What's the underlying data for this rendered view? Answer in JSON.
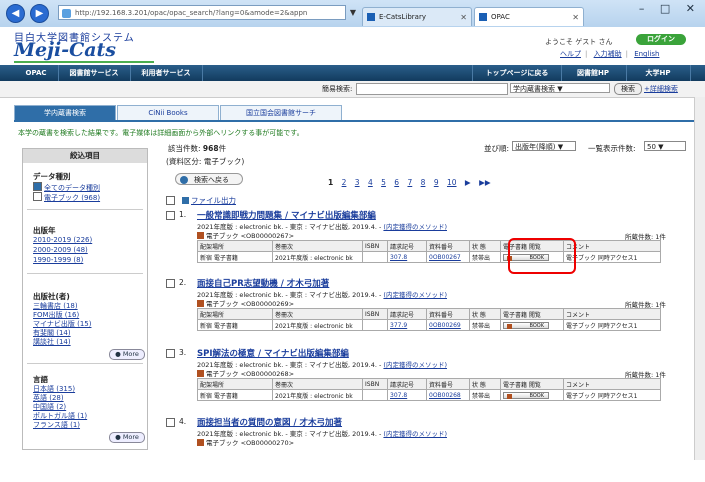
{
  "browser": {
    "address": "http://192.168.3.201/opac/opac_search/?lang=0&amode=2&appn",
    "addr_ctrl": "▼",
    "tabs": [
      {
        "label": "E-CatsLibrary"
      },
      {
        "label": "OPAC"
      }
    ],
    "window_controls": "– □ ✕",
    "back": "◀",
    "forward": "▶"
  },
  "header": {
    "univ": "目白大学図書館システム",
    "logo": "Meji-Cats",
    "welcome": "ようこそ ゲスト さん",
    "login": "ログイン",
    "links": [
      "ヘルプ",
      "入力補助",
      "English"
    ]
  },
  "nav": {
    "items": [
      "OPAC",
      "図書館サービス",
      "利用者サービス"
    ],
    "right_items": [
      "トップページに戻る",
      "図書館HP",
      "大学HP"
    ]
  },
  "search": {
    "label": "簡易検索:",
    "select": "学内蔵書検索 ▼",
    "button": "検索",
    "advanced": "+詳細検索"
  },
  "content_tabs": [
    "学内蔵書検索",
    "CiNii Books",
    "国立国会図書館サーチ"
  ],
  "notice": "本学の蔵書を検索した結果です。電子媒体は詳細画面から外部へリンクする事が可能です。",
  "sidebar": {
    "title": "絞込項目",
    "groups": [
      {
        "head": "データ種別",
        "items": [
          "全てのデータ種別",
          "電子ブック (968)"
        ]
      },
      {
        "head": "出版年",
        "items": [
          "2010-2019 (226)",
          "2000-2009 (48)",
          "1990-1999 (8)"
        ]
      },
      {
        "head": "出版社(者)",
        "items": [
          "三輪書店 (18)",
          "FOM出版 (16)",
          "マイナビ出版 (15)",
          "有斐閣 (14)",
          "講談社 (14)"
        ]
      },
      {
        "head": "言語",
        "items": [
          "日本語 (315)",
          "英語 (28)",
          "中国語 (2)",
          "ポルトガル語 (1)",
          "フランス語 (1)"
        ]
      }
    ],
    "more": "More"
  },
  "results": {
    "count_label": "該当件数:",
    "count": "968",
    "count_unit": "件",
    "filter": "(資料区分: 電子ブック)",
    "back": "検索へ戻る",
    "file_output": "ファイル出力",
    "pages": [
      "1",
      "2",
      "3",
      "4",
      "5",
      "6",
      "7",
      "8",
      "9",
      "10"
    ],
    "next": "▶",
    "last": "▶▶",
    "sort_label": "並び順:",
    "sort_value": "出版年(降順)",
    "display_label": "一覧表示件数:",
    "display_value": "50"
  },
  "table_headers": [
    "配架場所",
    "巻冊次",
    "ISBN",
    "請求記号",
    "資料番号",
    "状 態",
    "電子書籍 閲覧",
    "コメント"
  ],
  "book_label": "BOOK",
  "records": [
    {
      "num": "1.",
      "title": "一般常識即戦力問題集 / マイナビ出版編集部編",
      "pub": "2021年度版 : electronic bk. - 東京 : マイナビ出版, 2019.4. - ",
      "series": "(内定獲得のメソッド)",
      "id": "電子ブック <OB00000267>",
      "held": "所蔵件数: 1件",
      "row": [
        "新宿 電子書籍",
        "2021年度版 : electronic bk",
        "",
        "307.8",
        "0OB00267",
        "禁帯出",
        "",
        "電子ブック 同時アクセス1"
      ]
    },
    {
      "num": "2.",
      "title": "面接自己PR志望動機 / 才木弓加著",
      "pub": "2021年度版 : electronic bk. - 東京 : マイナビ出版, 2019.4. - ",
      "series": "(内定獲得のメソッド)",
      "id": "電子ブック <OB00000269>",
      "held": "所蔵件数: 1件",
      "row": [
        "新宿 電子書籍",
        "2021年度版 : electronic bk",
        "",
        "377.9",
        "0OB00269",
        "禁帯出",
        "",
        "電子ブック 同時アクセス1"
      ]
    },
    {
      "num": "3.",
      "title": "SPI解法の極意 / マイナビ出版編集部編",
      "pub": "2021年度版 : electronic bk. - 東京 : マイナビ出版, 2019.4. - ",
      "series": "(内定獲得のメソッド)",
      "id": "電子ブック <OB00000268>",
      "held": "所蔵件数: 1件",
      "row": [
        "新宿 電子書籍",
        "2021年度版 : electronic bk",
        "",
        "307.8",
        "0OB00268",
        "禁帯出",
        "",
        "電子ブック 同時アクセス1"
      ]
    },
    {
      "num": "4.",
      "title": "面接担当者の質問の意図 / 才木弓加著",
      "pub": "2021年度版 : electronic bk. - 東京 : マイナビ出版, 2019.4. - ",
      "series": "(内定獲得のメソッド)",
      "id": "電子ブック <OB00000270>",
      "held": "",
      "row": []
    }
  ]
}
